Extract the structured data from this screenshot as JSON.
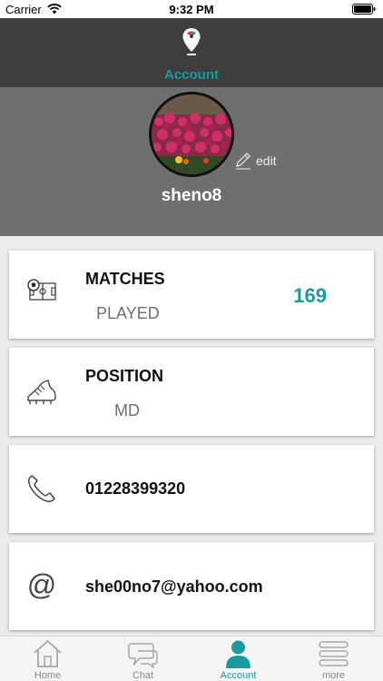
{
  "status_bar": {
    "carrier": "Carrier",
    "time": "9:32 PM"
  },
  "nav": {
    "title": "Account"
  },
  "profile": {
    "username": "sheno8",
    "edit_label": "edit"
  },
  "cards": {
    "matches": {
      "title": "MATCHES",
      "subtitle": "PLAYED",
      "count": "169"
    },
    "position": {
      "title": "POSITION",
      "value": "MD"
    },
    "phone": {
      "value": "01228399320"
    },
    "email": {
      "value": "she00no7@yahoo.com"
    }
  },
  "tabs": [
    {
      "label": "Home",
      "icon": "home-icon"
    },
    {
      "label": "Chat",
      "icon": "chat-icon"
    },
    {
      "label": "Account",
      "icon": "account-icon"
    },
    {
      "label": "more",
      "icon": "menu-icon"
    }
  ],
  "colors": {
    "accent": "#1a9aa0",
    "nav_bg": "#3e3e3e",
    "header_bg": "#6f6f6f",
    "page_bg": "#ebebeb"
  }
}
